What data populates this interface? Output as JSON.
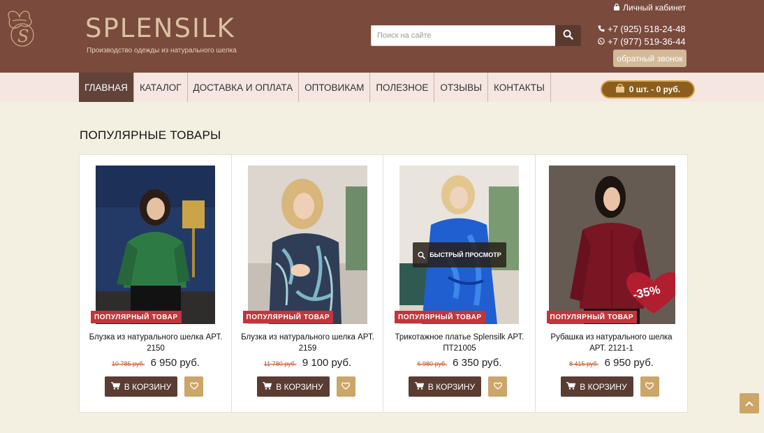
{
  "brand": {
    "name": "SPLENSILK",
    "tagline": "Производство одежды из натурального шелка"
  },
  "search": {
    "placeholder": "Поиск на сайте",
    "value": ""
  },
  "header": {
    "account_label": "Личный кабинет",
    "phone1": "+7 (925) 518-24-48",
    "phone2": "+7 (977) 519-36-44",
    "callback_label": "обратный звонок"
  },
  "nav": {
    "items": [
      {
        "label": "ГЛАВНАЯ",
        "active": true
      },
      {
        "label": "КАТАЛОГ"
      },
      {
        "label": "ДОСТАВКА И ОПЛАТА"
      },
      {
        "label": "ОПТОВИКАМ"
      },
      {
        "label": "ПОЛЕЗНОЕ"
      },
      {
        "label": "ОТЗЫВЫ"
      },
      {
        "label": "КОНТАКТЫ"
      }
    ],
    "cart_label": "0 шт. - 0 руб."
  },
  "section_title": "ПОПУЛЯРНЫЕ ТОВАРЫ",
  "products": [
    {
      "badge": "ПОПУЛЯРНЫЙ ТОВАР",
      "name": "Блузка из натурального шелка АРТ. 2150",
      "old_price": "10 785 руб.",
      "price": "6 950 руб.",
      "buy_label": "В КОРЗИНУ"
    },
    {
      "badge": "ПОПУЛЯРНЫЙ ТОВАР",
      "name": "Блузка из натурального шелка АРТ. 2159",
      "old_price": "11 780 руб.",
      "price": "9 100 руб.",
      "buy_label": "В КОРЗИНУ"
    },
    {
      "badge": "ПОПУЛЯРНЫЙ ТОВАР",
      "name": "Трикотажное платье Splensilk АРТ. ПТ21005",
      "old_price": "6 980 руб.",
      "price": "6 350 руб.",
      "buy_label": "В КОРЗИНУ",
      "quick_view": "БЫСТРЫЙ ПРОСМОТР"
    },
    {
      "badge": "ПОПУЛЯРНЫЙ ТОВАР",
      "name": "Рубашка из натурального шелка АРТ. 2121-1",
      "old_price": "8 415 руб.",
      "price": "6 950 руб.",
      "buy_label": "В КОРЗИНУ",
      "discount": "-35%"
    }
  ],
  "colors": {
    "header_bg": "#7a4a3d",
    "nav_bg": "#f5e6e1",
    "nav_active": "#62433a",
    "page_bg": "#f3f0e2",
    "badge": "#c0363c",
    "button_dark": "#5a3c33",
    "button_gold": "#cca569",
    "old_price": "#c5502f"
  },
  "icons": [
    "logo-emblem",
    "lock-icon",
    "phone-icon",
    "whatsapp-icon",
    "search-icon",
    "basket-icon",
    "cart-icon",
    "heart-icon",
    "arrow-up-icon"
  ]
}
